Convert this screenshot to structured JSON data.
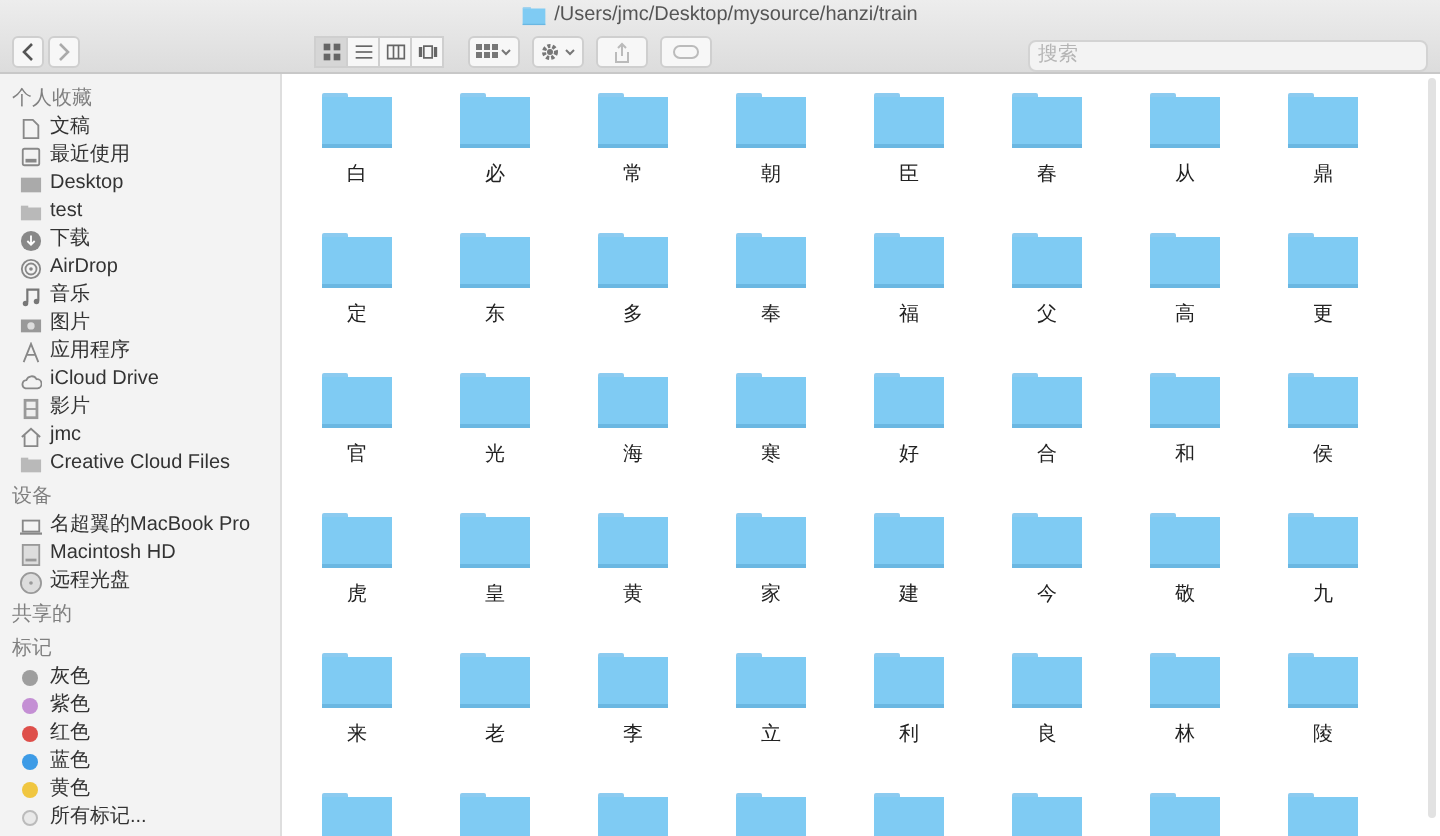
{
  "window": {
    "title": "/Users/jmc/Desktop/mysource/hanzi/train"
  },
  "toolbar": {
    "view_modes": [
      {
        "kind": "icons",
        "selected": true
      },
      {
        "kind": "list",
        "selected": false
      },
      {
        "kind": "columns",
        "selected": false
      },
      {
        "kind": "gallery",
        "selected": false
      }
    ],
    "search": {
      "placeholder": "搜索"
    }
  },
  "sidebar": {
    "sections": [
      {
        "title": "个人收藏",
        "items": [
          {
            "label": "文稿",
            "kind": "document"
          },
          {
            "label": "最近使用",
            "kind": "recent"
          },
          {
            "label": "Desktop",
            "kind": "desktop"
          },
          {
            "label": "test",
            "kind": "folder"
          },
          {
            "label": "下载",
            "kind": "download"
          },
          {
            "label": "AirDrop",
            "kind": "airdrop"
          },
          {
            "label": "音乐",
            "kind": "music"
          },
          {
            "label": "图片",
            "kind": "pictures"
          },
          {
            "label": "应用程序",
            "kind": "apps"
          },
          {
            "label": "iCloud Drive",
            "kind": "cloud"
          },
          {
            "label": "影片",
            "kind": "movies"
          },
          {
            "label": "jmc",
            "kind": "home"
          },
          {
            "label": "Creative Cloud Files",
            "kind": "folder"
          }
        ]
      },
      {
        "title": "设备",
        "items": [
          {
            "label": "名超翼的MacBook Pro",
            "kind": "laptop"
          },
          {
            "label": "Macintosh HD",
            "kind": "disk"
          },
          {
            "label": "远程光盘",
            "kind": "disc"
          }
        ]
      },
      {
        "title": "共享的"
      },
      {
        "title": "标记",
        "items": [
          {
            "label": "灰色",
            "kind": "tag",
            "color": "#9e9e9e"
          },
          {
            "label": "紫色",
            "kind": "tag",
            "color": "#c48fd4"
          },
          {
            "label": "红色",
            "kind": "tag",
            "color": "#de4f4a"
          },
          {
            "label": "蓝色",
            "kind": "tag",
            "color": "#3d9be6"
          },
          {
            "label": "黄色",
            "kind": "tag",
            "color": "#f0c640"
          },
          {
            "label": "所有标记...",
            "kind": "alltags"
          }
        ]
      }
    ]
  },
  "folders": [
    {
      "kind": "labeled",
      "name": "白"
    },
    {
      "kind": "labeled",
      "name": "必"
    },
    {
      "kind": "labeled",
      "name": "常"
    },
    {
      "kind": "labeled",
      "name": "朝"
    },
    {
      "kind": "labeled",
      "name": "臣"
    },
    {
      "kind": "labeled",
      "name": "春"
    },
    {
      "kind": "labeled",
      "name": "从"
    },
    {
      "kind": "labeled",
      "name": "鼎"
    },
    {
      "kind": "labeled",
      "name": "定"
    },
    {
      "kind": "labeled",
      "name": "东"
    },
    {
      "kind": "labeled",
      "name": "多"
    },
    {
      "kind": "labeled",
      "name": "奉"
    },
    {
      "kind": "labeled",
      "name": "福"
    },
    {
      "kind": "labeled",
      "name": "父"
    },
    {
      "kind": "labeled",
      "name": "高"
    },
    {
      "kind": "labeled",
      "name": "更"
    },
    {
      "kind": "labeled",
      "name": "官"
    },
    {
      "kind": "labeled",
      "name": "光"
    },
    {
      "kind": "labeled",
      "name": "海"
    },
    {
      "kind": "labeled",
      "name": "寒"
    },
    {
      "kind": "labeled",
      "name": "好"
    },
    {
      "kind": "labeled",
      "name": "合"
    },
    {
      "kind": "labeled",
      "name": "和"
    },
    {
      "kind": "labeled",
      "name": "侯"
    },
    {
      "kind": "labeled",
      "name": "虎"
    },
    {
      "kind": "labeled",
      "name": "皇"
    },
    {
      "kind": "labeled",
      "name": "黄"
    },
    {
      "kind": "labeled",
      "name": "家"
    },
    {
      "kind": "labeled",
      "name": "建"
    },
    {
      "kind": "labeled",
      "name": "今"
    },
    {
      "kind": "labeled",
      "name": "敬"
    },
    {
      "kind": "labeled",
      "name": "九"
    },
    {
      "kind": "labeled",
      "name": "来"
    },
    {
      "kind": "labeled",
      "name": "老"
    },
    {
      "kind": "labeled",
      "name": "李"
    },
    {
      "kind": "labeled",
      "name": "立"
    },
    {
      "kind": "labeled",
      "name": "利"
    },
    {
      "kind": "labeled",
      "name": "良"
    },
    {
      "kind": "labeled",
      "name": "林"
    },
    {
      "kind": "labeled",
      "name": "陵"
    },
    {
      "kind": "cropped"
    },
    {
      "kind": "cropped"
    },
    {
      "kind": "cropped"
    },
    {
      "kind": "cropped"
    },
    {
      "kind": "cropped"
    },
    {
      "kind": "cropped"
    },
    {
      "kind": "cropped"
    },
    {
      "kind": "cropped"
    }
  ]
}
